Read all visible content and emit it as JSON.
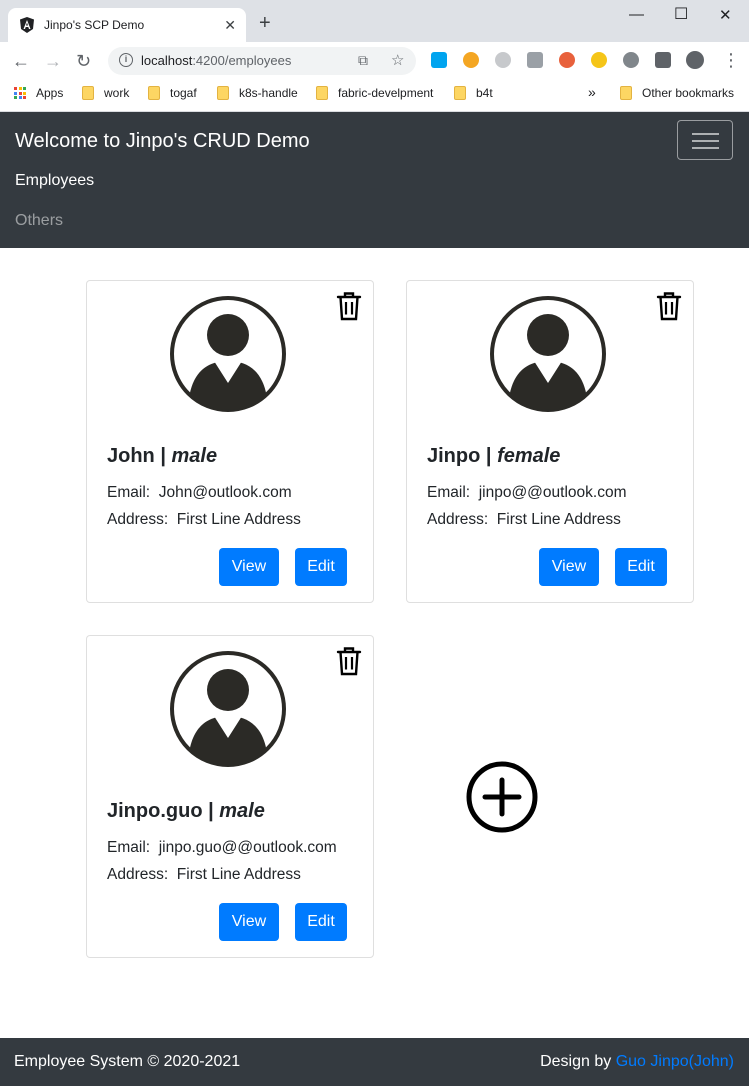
{
  "browser": {
    "tab_title": "Jinpo's SCP Demo",
    "url_host": "localhost",
    "url_path": ":4200/employees",
    "bookmarks": [
      "Apps",
      "work",
      "togaf",
      "k8s-handle",
      "fabric-develpment",
      "b4t"
    ],
    "other_bookmarks": "Other bookmarks",
    "overflow": "»"
  },
  "navbar": {
    "brand": "Welcome to Jinpo's CRUD Demo",
    "links": [
      "Employees",
      "Others"
    ]
  },
  "employees": [
    {
      "name": "John",
      "gender": "male",
      "email_label": "Email:",
      "email": "John@outlook.com",
      "address_label": "Address:",
      "address": "First Line Address",
      "view_label": "View",
      "edit_label": "Edit"
    },
    {
      "name": "Jinpo",
      "gender": "female",
      "email_label": "Email:",
      "email": "jinpo@@outlook.com",
      "address_label": "Address:",
      "address": "First Line Address",
      "view_label": "View",
      "edit_label": "Edit"
    },
    {
      "name": "Jinpo.guo",
      "gender": "male",
      "email_label": "Email:",
      "email": "jinpo.guo@@outlook.com",
      "address_label": "Address:",
      "address": "First Line Address",
      "view_label": "View",
      "edit_label": "Edit"
    }
  ],
  "footer": {
    "left": "Employee System © 2020-2021",
    "right_prefix": "Design by",
    "right_link": "Guo Jinpo(John)"
  },
  "icons": {
    "avatar": "user-avatar-icon",
    "delete": "trash-icon",
    "add": "plus-circle-icon"
  },
  "colors": {
    "navbar_bg": "#343a40",
    "primary": "#007bff",
    "text": "#212529"
  }
}
